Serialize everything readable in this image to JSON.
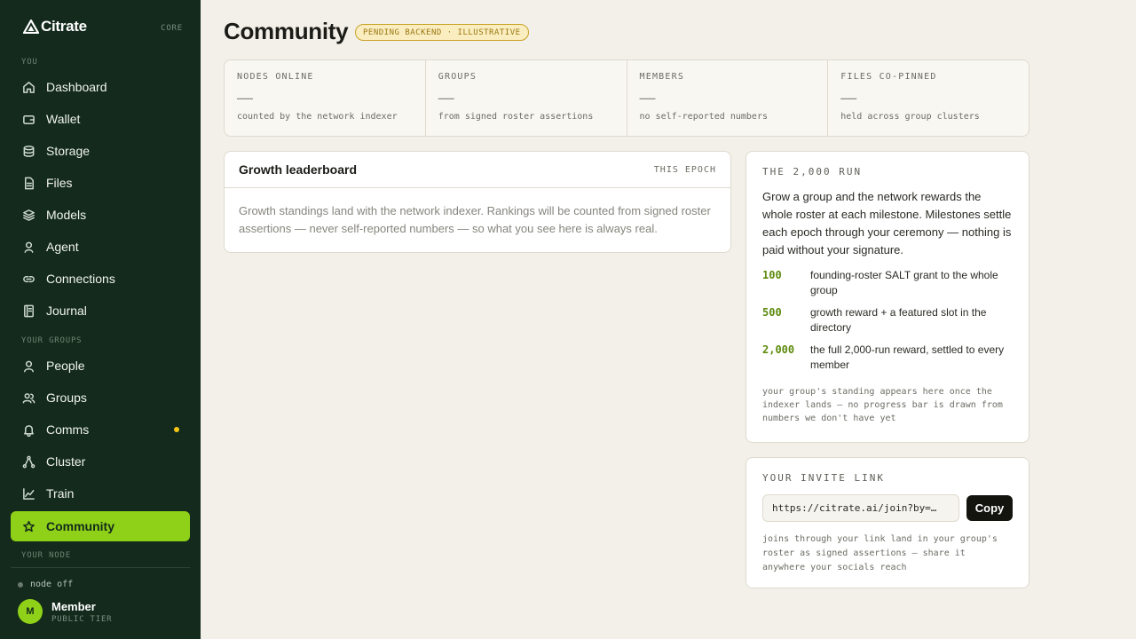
{
  "brand": {
    "name": "Citrate",
    "edition": "CORE"
  },
  "sidebar": {
    "sections": {
      "you": "YOU",
      "groups": "YOUR GROUPS",
      "node": "YOUR NODE"
    },
    "items": [
      {
        "label": "Dashboard",
        "icon": "home-icon"
      },
      {
        "label": "Wallet",
        "icon": "wallet-icon"
      },
      {
        "label": "Storage",
        "icon": "database-icon"
      },
      {
        "label": "Files",
        "icon": "file-icon"
      },
      {
        "label": "Models",
        "icon": "layers-icon"
      },
      {
        "label": "Agent",
        "icon": "user-icon"
      },
      {
        "label": "Connections",
        "icon": "link-icon"
      },
      {
        "label": "Journal",
        "icon": "book-icon"
      },
      {
        "label": "People",
        "icon": "person-icon"
      },
      {
        "label": "Groups",
        "icon": "users-icon"
      },
      {
        "label": "Comms",
        "icon": "bell-icon"
      },
      {
        "label": "Cluster",
        "icon": "nodes-icon"
      },
      {
        "label": "Train",
        "icon": "chart-icon"
      },
      {
        "label": "Community",
        "icon": "star-icon"
      }
    ],
    "active": "Community",
    "node_status": "node off",
    "user": {
      "initial": "M",
      "name": "Member",
      "tier": "PUBLIC TIER"
    }
  },
  "page": {
    "title": "Community",
    "badge": "PENDING BACKEND · ILLUSTRATIVE"
  },
  "stats": [
    {
      "label": "NODES ONLINE",
      "value": "—",
      "sub": "counted by the network indexer"
    },
    {
      "label": "GROUPS",
      "value": "—",
      "sub": "from signed roster assertions"
    },
    {
      "label": "MEMBERS",
      "value": "—",
      "sub": "no self-reported numbers"
    },
    {
      "label": "FILES CO-PINNED",
      "value": "—",
      "sub": "held across group clusters"
    }
  ],
  "leaderboard": {
    "title": "Growth leaderboard",
    "meta": "THIS EPOCH",
    "body": "Growth standings land with the network indexer. Rankings will be counted from signed roster assertions — never self-reported numbers — so what you see here is always real."
  },
  "run": {
    "title": "THE 2,000 RUN",
    "description": "Grow a group and the network rewards the whole roster at each milestone. Milestones settle each epoch through your ceremony — nothing is paid without your signature.",
    "milestones": [
      {
        "number": "100",
        "text": "founding-roster SALT grant to the whole group"
      },
      {
        "number": "500",
        "text": "growth reward + a featured slot in the directory"
      },
      {
        "number": "2,000",
        "text": "the full 2,000-run reward, settled to every member"
      }
    ],
    "note": "your group's standing appears here once the indexer lands — no progress bar is drawn from numbers we don't have yet"
  },
  "invite": {
    "title": "YOUR INVITE LINK",
    "link": "https://citrate.ai/join?by=…",
    "copy_label": "Copy",
    "note": "joins through your link land in your group's roster as signed assertions — share it anywhere your socials reach"
  }
}
